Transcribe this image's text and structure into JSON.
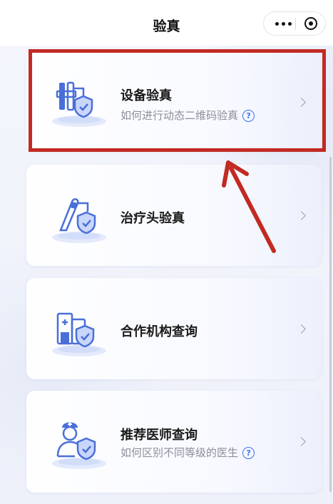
{
  "header": {
    "title": "验真",
    "more_icon": "more-dots-icon",
    "close_icon": "target-circle-icon"
  },
  "cards": [
    {
      "label": "设备验真",
      "sub": "如何进行动态二维码验真",
      "icon": "device-shield-icon"
    },
    {
      "label": "治疗头验真",
      "sub": "",
      "icon": "treatment-head-shield-icon"
    },
    {
      "label": "合作机构查询",
      "sub": "",
      "icon": "building-shield-icon"
    },
    {
      "label": "推荐医师查询",
      "sub": "如何区别不同等级的医生",
      "icon": "doctor-shield-icon"
    }
  ],
  "help_icon_glyph": "?",
  "colors": {
    "accent": "#3d6ff0",
    "highlight": "#c22a23",
    "icon_blue": "#4a6fd8"
  }
}
